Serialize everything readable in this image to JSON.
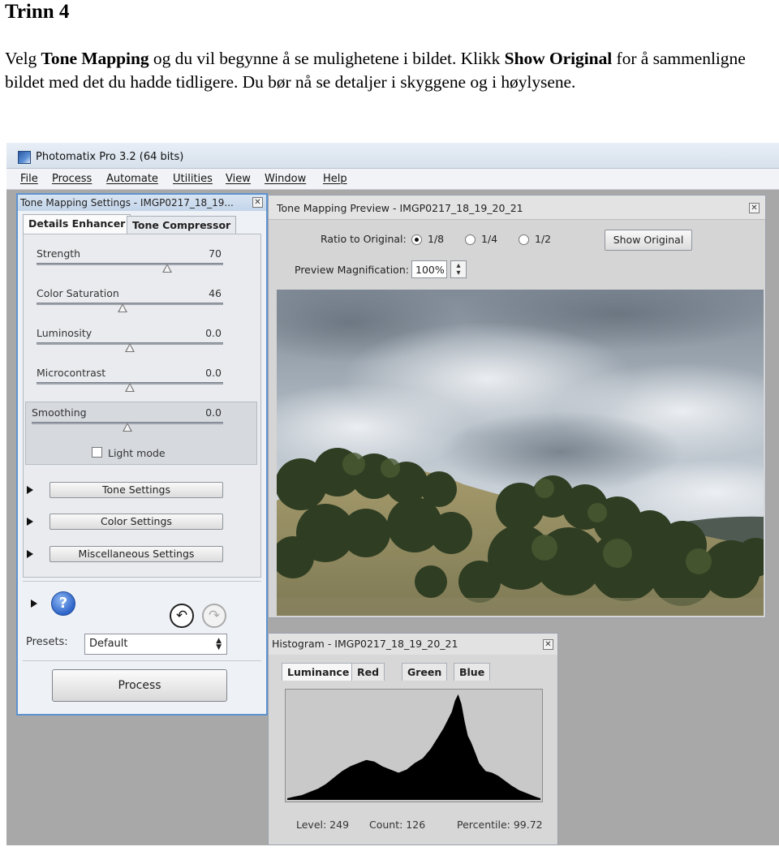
{
  "heading": "Trinn 4",
  "instructions": {
    "p1": "Velg ",
    "b1": "Tone Mapping",
    "p2": " og du vil begynne å se mulighetene i bildet. Klikk ",
    "b2": "Show Original",
    "p3": " for å sammenligne bildet med det du hadde tidligere. Du bør nå se detaljer i skyggene og i høylysene."
  },
  "app": {
    "title": "Photomatix Pro 3.2 (64 bits)",
    "menu": [
      "File",
      "Process",
      "Automate",
      "Utilities",
      "View",
      "Window",
      "Help"
    ]
  },
  "settings_panel": {
    "title": "Tone Mapping Settings - IMGP0217_18_19...",
    "tabs": [
      "Details Enhancer",
      "Tone Compressor"
    ],
    "sliders": [
      {
        "label": "Strength",
        "value": "70",
        "fraction": 0.7
      },
      {
        "label": "Color Saturation",
        "value": "46",
        "fraction": 0.46
      },
      {
        "label": "Luminosity",
        "value": "0.0",
        "fraction": 0.5
      },
      {
        "label": "Microcontrast",
        "value": "0.0",
        "fraction": 0.5
      },
      {
        "label": "Smoothing",
        "value": "0.0",
        "fraction": 0.5
      }
    ],
    "light_mode_label": "Light mode",
    "light_mode_checked": false,
    "sections": [
      "Tone Settings",
      "Color Settings",
      "Miscellaneous Settings"
    ],
    "help_glyph": "?",
    "undo_glyph": "↶",
    "redo_glyph": "↷",
    "presets_label": "Presets:",
    "preset_value": "Default",
    "process_label": "Process"
  },
  "preview": {
    "title": "Tone Mapping Preview - IMGP0217_18_19_20_21",
    "ratio_label": "Ratio to Original:",
    "ratio_options": [
      "1/8",
      "1/4",
      "1/2"
    ],
    "ratio_selected": "1/8",
    "show_original_label": "Show Original",
    "magnification_label": "Preview Magnification:",
    "magnification_value": "100%"
  },
  "histogram": {
    "title": "Histogram - IMGP0217_18_19_20_21",
    "tabs": [
      "Luminance",
      "Red",
      "Green",
      "Blue"
    ],
    "active_tab": "Luminance",
    "level": "Level: 249",
    "count": "Count: 126",
    "percentile": "Percentile: 99.72"
  },
  "icons": {
    "close": "close-icon",
    "help": "help-icon",
    "undo": "undo-icon",
    "redo": "redo-icon",
    "expand": "triangle-right-icon"
  },
  "colors": {
    "panel_border": "#5f93cf",
    "workspace": "#a8a8a8"
  }
}
